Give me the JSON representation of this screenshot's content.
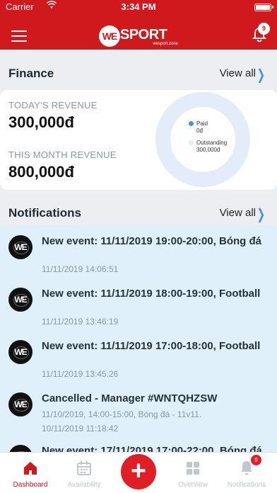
{
  "status_bar": {
    "carrier": "Carrier",
    "time": "3:34 PM"
  },
  "header": {
    "logo_mark": "WE",
    "logo_text": "SPORT",
    "logo_sub": "wesport.zone",
    "notification_count": "9",
    "colors": {
      "brand": "#d0191d",
      "accent": "#4a90e2"
    }
  },
  "finance": {
    "title": "Finance",
    "view_all": "View all",
    "today_label": "TODAY'S REVENUE",
    "today_value": "300,000đ",
    "month_label": "THIS MONTH REVENUE",
    "month_value": "800,000đ",
    "chart_legend": [
      {
        "label": "Paid",
        "value": "0đ",
        "color": "#4a90e2"
      },
      {
        "label": "Outstanding",
        "value": "300,000đ",
        "color": "#e3ecf8"
      }
    ]
  },
  "notifications": {
    "title": "Notifications",
    "view_all": "View all",
    "items": [
      {
        "avatar": "WE",
        "title": "New event: 11/11/2019 19:00-20:00, Bóng đá",
        "time": "11/11/2019 14:06:51"
      },
      {
        "avatar": "WE",
        "title": "New event: 11/11/2019 18:00-19:00, Football",
        "time": "11/11/2019 13:46:19"
      },
      {
        "avatar": "WE",
        "title": "New event: 11/11/2019 17:00-18:00, Football",
        "time": "11/11/2019 13:45:26"
      },
      {
        "avatar": "WE",
        "title": "Cancelled - Manager #WNTQHZSW",
        "detail": "11/10/2019, 14:00-15:00, Bóng đá - 11v11.",
        "time": "10/11/2019 11:18:42"
      },
      {
        "avatar": "WE",
        "title": "New event: 17/11/2019 17:00-22:00, Bóng đá",
        "time": ""
      }
    ]
  },
  "tab_bar": {
    "tabs": [
      {
        "label": "Dashboard",
        "icon": "home-icon"
      },
      {
        "label": "Availability",
        "icon": "calendar-icon"
      },
      {
        "label": "Overview",
        "icon": "grid-icon"
      },
      {
        "label": "Notifications",
        "icon": "bell-icon",
        "badge": "9"
      }
    ],
    "add_label": "+"
  }
}
